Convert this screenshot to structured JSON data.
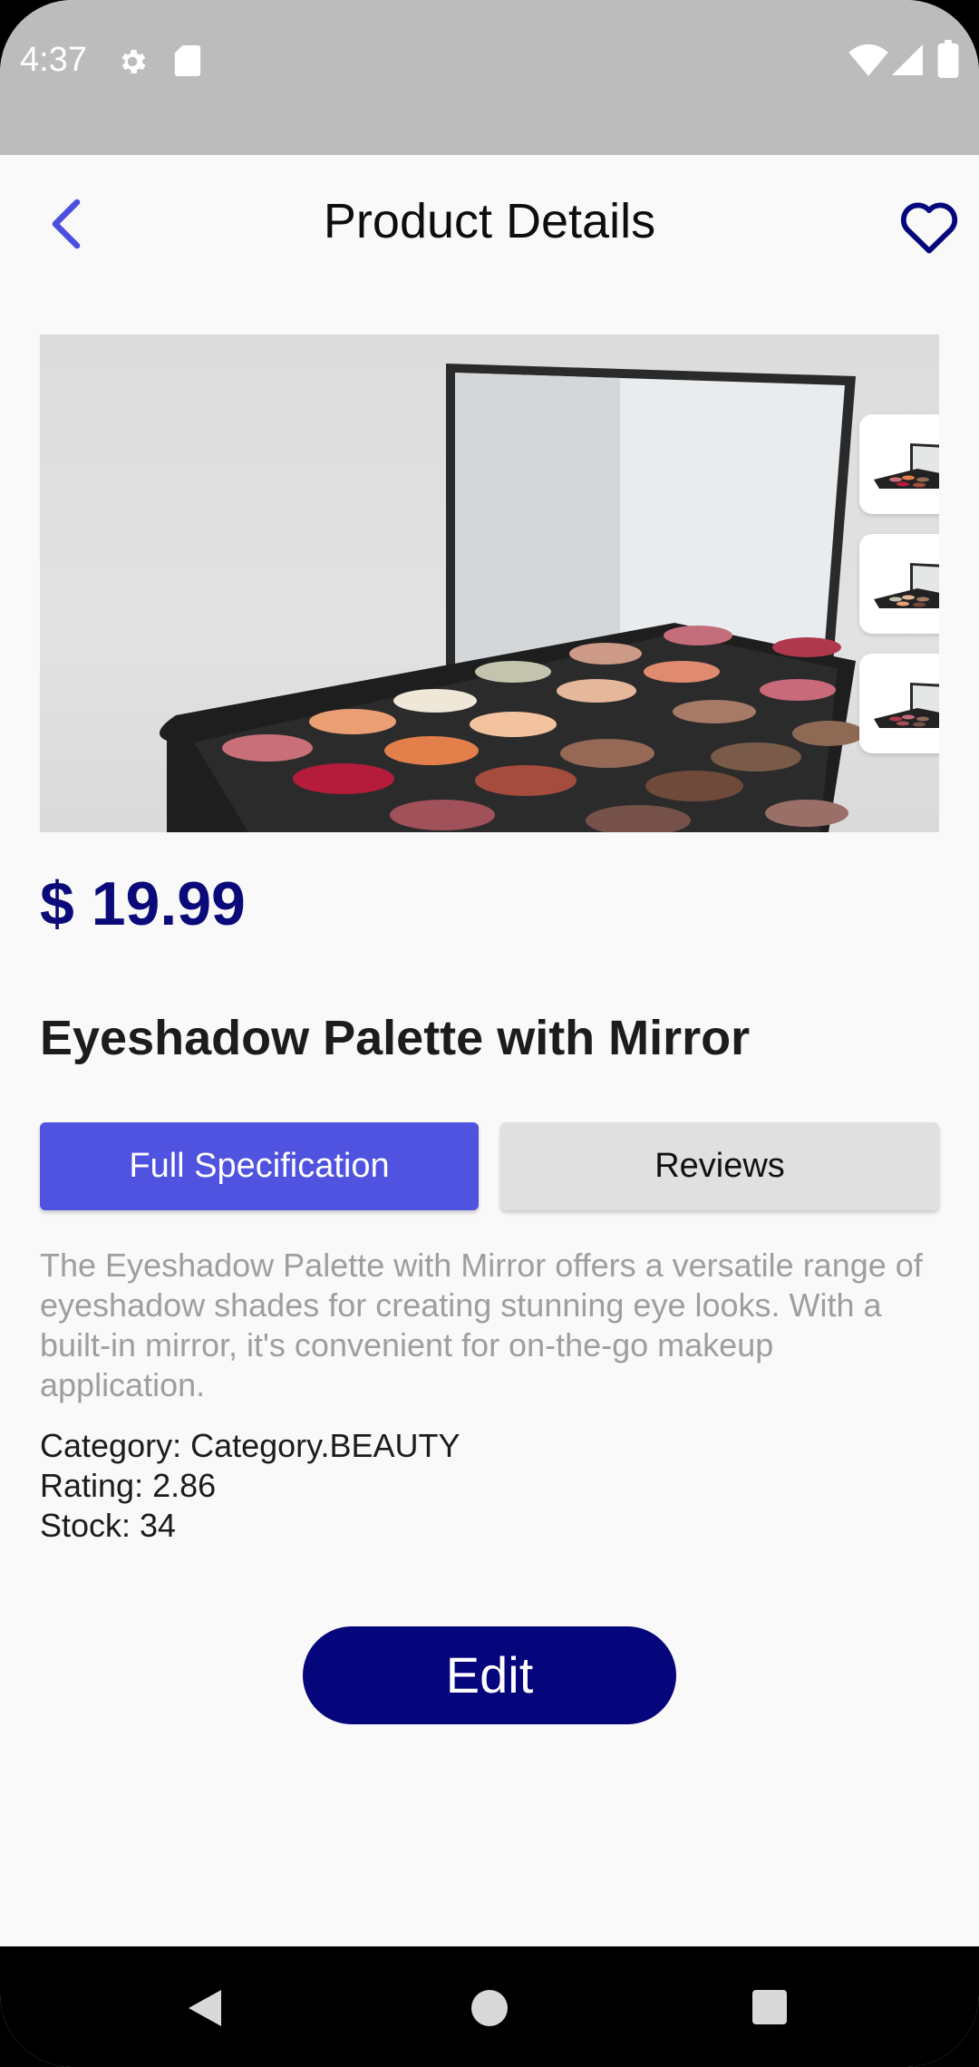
{
  "status_bar": {
    "time": "4:37",
    "icons": [
      "settings-icon",
      "sd-card-icon",
      "wifi-icon",
      "signal-icon",
      "battery-icon"
    ]
  },
  "app_bar": {
    "title": "Product Details",
    "back_icon": "chevron-left-icon",
    "favorite_icon": "heart-outline-icon"
  },
  "product": {
    "price": "$ 19.99",
    "name": "Eyeshadow Palette with Mirror",
    "description": "The Eyeshadow Palette with Mirror offers a versatile range of eyeshadow shades for creating stunning eye looks. With a built-in mirror, it's convenient for on-the-go makeup application.",
    "category": "Category: Category.BEAUTY",
    "rating": "Rating: 2.86",
    "stock": "Stock: 34",
    "thumbnail_count": 3
  },
  "tabs": {
    "spec_label": "Full Specification",
    "reviews_label": "Reviews",
    "active": "spec"
  },
  "actions": {
    "edit_label": "Edit"
  },
  "colors": {
    "accent": "#5053e0",
    "primary_dark": "#05057c",
    "price": "#0a0a7a",
    "back_icon": "#4b4fe0"
  },
  "nav_bar": {
    "icons": [
      "back-triangle-icon",
      "home-circle-icon",
      "recents-square-icon"
    ]
  }
}
